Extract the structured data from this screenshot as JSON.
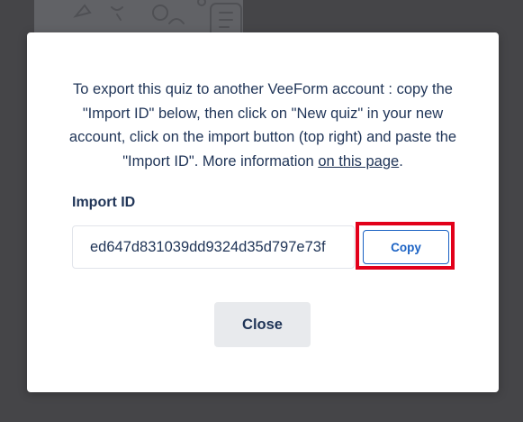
{
  "dialog": {
    "description_before_link": "To export this quiz to another VeeForm account : copy the \"Import ID\" below, then click on \"New quiz\" in your new account, click on the import button (top right) and paste the \"Import ID\". More information ",
    "link_text": "on this page",
    "description_after_link": ".",
    "import_id_label": "Import ID",
    "import_id_value": "ed647d831039dd9324d35d797e73f",
    "copy_label": "Copy",
    "close_label": "Close"
  },
  "colors": {
    "text": "#1f3457",
    "accent": "#1b62c4",
    "highlight": "#e2001a",
    "overlay": "#4b4b4e",
    "close_bg": "#e8eaed"
  },
  "icons": {
    "background_decoration": "doodle-illustration-icon"
  }
}
